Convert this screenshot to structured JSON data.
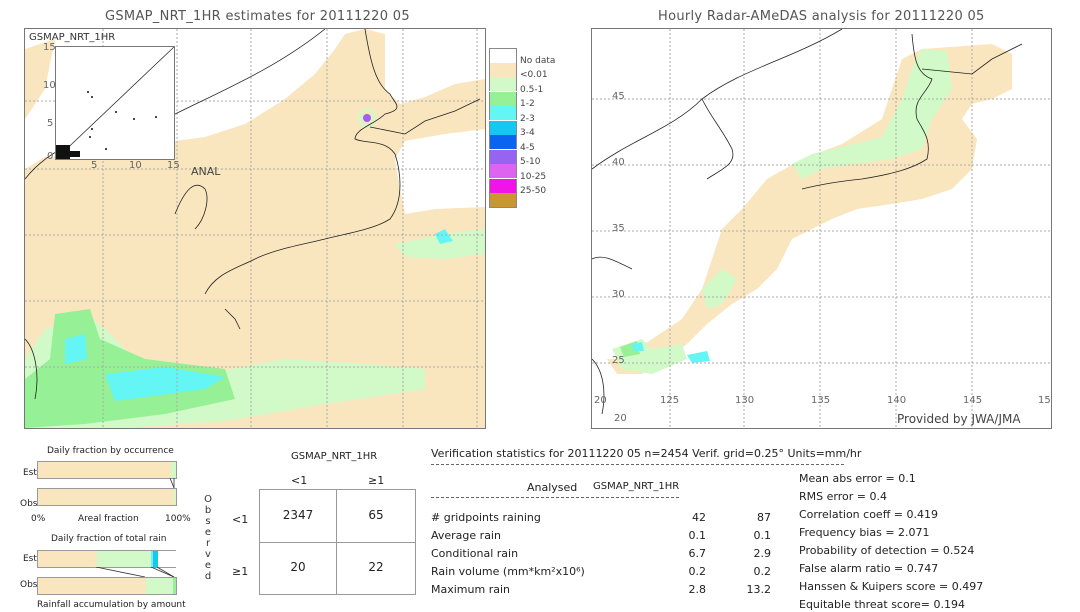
{
  "left_panel": {
    "title": "GSMAP_NRT_1HR estimates for 20111220 05",
    "inset": {
      "title": "GSMAP_NRT_1HR",
      "y_ticks": [
        "15",
        "10",
        "5",
        "0"
      ],
      "x_ticks": [
        "5",
        "10",
        "15"
      ],
      "x_label": "ANAL",
      "axis_max": 15
    }
  },
  "right_panel": {
    "title": "Hourly Radar-AMeDAS analysis for 20111220 05",
    "lat_ticks": [
      "45",
      "40",
      "35",
      "30",
      "25",
      "20"
    ],
    "lon_ticks": [
      "20",
      "125",
      "130",
      "135",
      "140",
      "145",
      "15"
    ],
    "credit": "Provided by JWA/JMA"
  },
  "legend": {
    "items": [
      {
        "label": "",
        "color": "#ffffff"
      },
      {
        "label": "No data",
        "color": "#fae6be"
      },
      {
        "label": "<0.01",
        "color": "#d2fac8"
      },
      {
        "label": "0.5-1",
        "color": "#96f096"
      },
      {
        "label": "1-2",
        "color": "#64f5f5"
      },
      {
        "label": "2-3",
        "color": "#14c8f0"
      },
      {
        "label": "3-4",
        "color": "#0a64f0"
      },
      {
        "label": "4-5",
        "color": "#9664f0"
      },
      {
        "label": "5-10",
        "color": "#dc64f0"
      },
      {
        "label": "10-25",
        "color": "#f014e6"
      },
      {
        "label": "25-50",
        "color": "#c89632"
      }
    ]
  },
  "occurrence": {
    "title": "Daily fraction by occurrence",
    "est_label": "Est",
    "obs_label": "Obs",
    "axis_left": "0%",
    "axis_mid": "Areal fraction",
    "axis_right": "100%",
    "est_fractions": [
      {
        "color": "#fae6be",
        "value": 0.965
      },
      {
        "color": "#d2fac8",
        "value": 0.035
      }
    ],
    "obs_fractions": [
      {
        "color": "#fae6be",
        "value": 0.983
      },
      {
        "color": "#d2fac8",
        "value": 0.017
      }
    ]
  },
  "total_rain": {
    "title": "Daily fraction of total rain",
    "est_label": "Est",
    "obs_label": "Obs",
    "footer": "Rainfall accumulation by amount",
    "est_fractions": [
      {
        "color": "#fae6be",
        "value": 0.43
      },
      {
        "color": "#d2fac8",
        "value": 0.39
      },
      {
        "color": "#64f5f5",
        "value": 0.015
      },
      {
        "color": "#14c8f0",
        "value": 0.035
      }
    ],
    "obs_fractions": [
      {
        "color": "#fae6be",
        "value": 0.78
      },
      {
        "color": "#d2fac8",
        "value": 0.195
      },
      {
        "color": "#96f096",
        "value": 0.025
      }
    ]
  },
  "contingency": {
    "title": "GSMAP_NRT_1HR",
    "col_headers": [
      "<1",
      "≥1"
    ],
    "row_headers": [
      "<1",
      "≥1"
    ],
    "side_label": [
      "O",
      "b",
      "s",
      "e",
      "r",
      "v",
      "e",
      "d"
    ],
    "cells": [
      [
        "2347",
        "65"
      ],
      [
        "20",
        "22"
      ]
    ]
  },
  "stats": {
    "header": "Verification statistics for 20111220 05   n=2454   Verif. grid=0.25°   Units=mm/hr",
    "col_analysed": "Analysed",
    "col_est": "GSMAP_NRT_1HR",
    "rows": [
      {
        "label": "# gridpoints raining",
        "analysed": "42",
        "est": "87"
      },
      {
        "label": "Average rain",
        "analysed": "0.1",
        "est": "0.1"
      },
      {
        "label": "Conditional rain",
        "analysed": "6.7",
        "est": "2.9"
      },
      {
        "label": "Rain volume (mm*km²x10⁶)",
        "analysed": "0.2",
        "est": "0.2"
      },
      {
        "label": "Maximum rain",
        "analysed": "2.8",
        "est": "13.2"
      }
    ],
    "scores": [
      "Mean abs error = 0.1",
      "RMS error = 0.4",
      "Correlation coeff = 0.419",
      "Frequency bias = 2.071",
      "Probability of detection = 0.524",
      "False alarm ratio = 0.747",
      "Hanssen & Kuipers score = 0.497",
      "Equitable threat score= 0.194"
    ]
  }
}
